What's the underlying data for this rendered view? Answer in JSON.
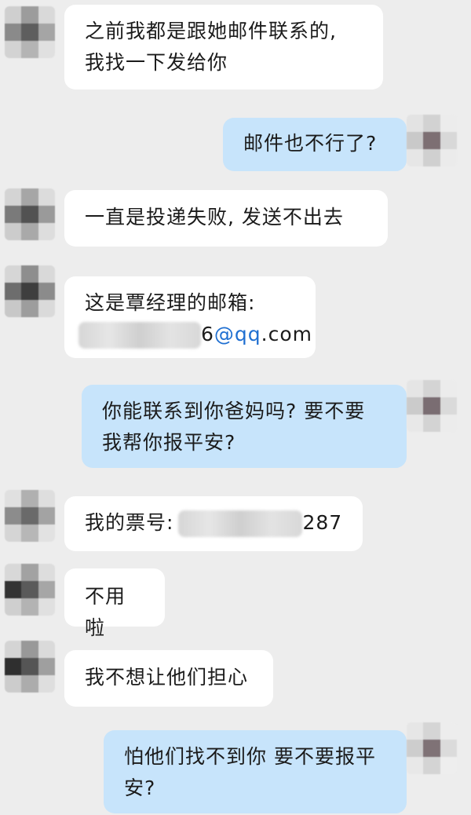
{
  "messages": [
    {
      "side": "in",
      "lines": [
        "之前我都是跟她邮件联系的,",
        "我找一下发给你"
      ]
    },
    {
      "side": "out",
      "text": "邮件也不行了?"
    },
    {
      "side": "in",
      "text": "一直是投递失败, 发送不出去"
    },
    {
      "side": "in",
      "line1": "这是覃经理的邮箱:",
      "email_visible_suffix": "6",
      "email_link": "@qq",
      "email_domain": ".com"
    },
    {
      "side": "out",
      "lines": [
        "你能联系到你爸妈吗? 要不要",
        "我帮你报平安?"
      ]
    },
    {
      "side": "in",
      "label": "我的票号:",
      "visible_suffix": "287"
    },
    {
      "side": "in",
      "text": "不用啦"
    },
    {
      "side": "in",
      "text": "我不想让他们担心"
    },
    {
      "side": "out",
      "lines": [
        "怕他们找不到你 要不要报平",
        "安?"
      ]
    }
  ],
  "colors": {
    "background": "#ededed",
    "incoming_bubble": "#ffffff",
    "outgoing_bubble": "#c7e4fb",
    "link": "#1f6fd1"
  }
}
